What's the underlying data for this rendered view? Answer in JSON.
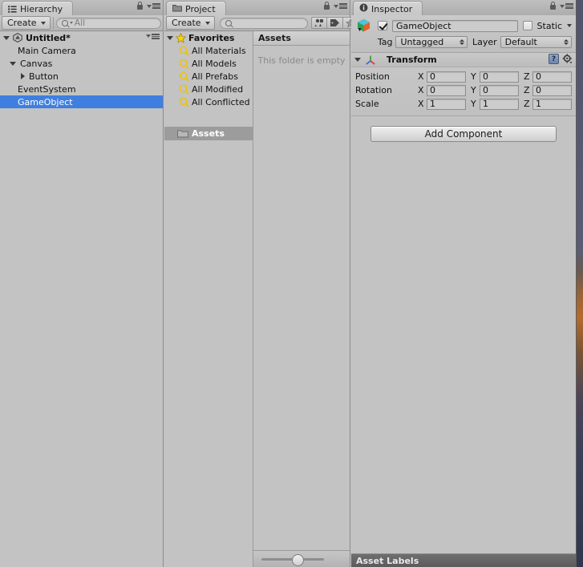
{
  "app": "Unity Editor",
  "hierarchy": {
    "tab_label": "Hierarchy",
    "tab_icon": "hierarchy-icon",
    "lock_icon": "lock-icon",
    "menu_icon": "panel-menu-icon",
    "toolbar": {
      "create_label": "Create",
      "create_caret": "caret-down-icon",
      "search_icon": "search-icon",
      "search_value": "All",
      "search_placeholder": "All"
    },
    "scene": {
      "name": "Untitled*",
      "expanded": true,
      "icon": "unity-scene-icon",
      "menu_icon": "scene-menu-icon"
    },
    "items": [
      {
        "label": "Main Camera",
        "indent": 1,
        "expandable": false,
        "expanded": false,
        "selected": false
      },
      {
        "label": "Canvas",
        "indent": 1,
        "expandable": true,
        "expanded": true,
        "selected": false
      },
      {
        "label": "Button",
        "indent": 2,
        "expandable": true,
        "expanded": false,
        "selected": false
      },
      {
        "label": "EventSystem",
        "indent": 1,
        "expandable": false,
        "expanded": false,
        "selected": false
      },
      {
        "label": "GameObject",
        "indent": 1,
        "expandable": false,
        "expanded": false,
        "selected": true
      }
    ],
    "selection_color": "#3f7fe0"
  },
  "project": {
    "tab_label": "Project",
    "tab_icon": "folder-icon",
    "lock_icon": "lock-icon",
    "menu_icon": "panel-menu-icon",
    "toolbar": {
      "create_label": "Create",
      "create_caret": "caret-down-icon",
      "search_icon": "search-icon",
      "search_value": "",
      "search_placeholder": "",
      "filter_buttons": [
        {
          "name": "filter-by-type-icon",
          "title": ""
        },
        {
          "name": "filter-by-label-icon",
          "title": ""
        },
        {
          "name": "filter-favorites-star-icon",
          "title": ""
        }
      ]
    },
    "favorites": {
      "label": "Favorites",
      "icon": "star-icon",
      "expanded": true,
      "items": [
        {
          "label": "All Materials",
          "icon": "saved-search-icon"
        },
        {
          "label": "All Models",
          "icon": "saved-search-icon"
        },
        {
          "label": "All Prefabs",
          "icon": "saved-search-icon"
        },
        {
          "label": "All Modified",
          "icon": "saved-search-icon"
        },
        {
          "label": "All Conflicted",
          "icon": "saved-search-icon"
        }
      ]
    },
    "assets_node": {
      "label": "Assets",
      "icon": "folder-icon",
      "selected": true
    },
    "breadcrumb": "Assets",
    "empty_message": "This folder is empty",
    "zoom_slider": {
      "name": "thumbnail-size-slider",
      "value": 56
    }
  },
  "inspector": {
    "tab_label": "Inspector",
    "tab_icon": "info-icon",
    "lock_icon": "lock-icon",
    "menu_icon": "panel-menu-icon",
    "object": {
      "icon": "gameobject-cube-icon",
      "enabled": true,
      "name": "GameObject",
      "name_placeholder": "",
      "static_label": "Static",
      "static_checked": false,
      "static_caret": "caret-down-icon",
      "tag_label": "Tag",
      "tag_value": "Untagged",
      "layer_label": "Layer",
      "layer_value": "Default"
    },
    "transform": {
      "title": "Transform",
      "icon": "transform-gizmo-icon",
      "expanded": true,
      "help_icon": "help-book-icon",
      "settings_icon": "gear-icon",
      "rows": [
        {
          "label": "Position",
          "x": "0",
          "y": "0",
          "z": "0"
        },
        {
          "label": "Rotation",
          "x": "0",
          "y": "0",
          "z": "0"
        },
        {
          "label": "Scale",
          "x": "1",
          "y": "1",
          "z": "1"
        }
      ],
      "axis_labels": [
        "X",
        "Y",
        "Z"
      ]
    },
    "add_component_label": "Add Component",
    "asset_labels_bar": "Asset Labels"
  }
}
